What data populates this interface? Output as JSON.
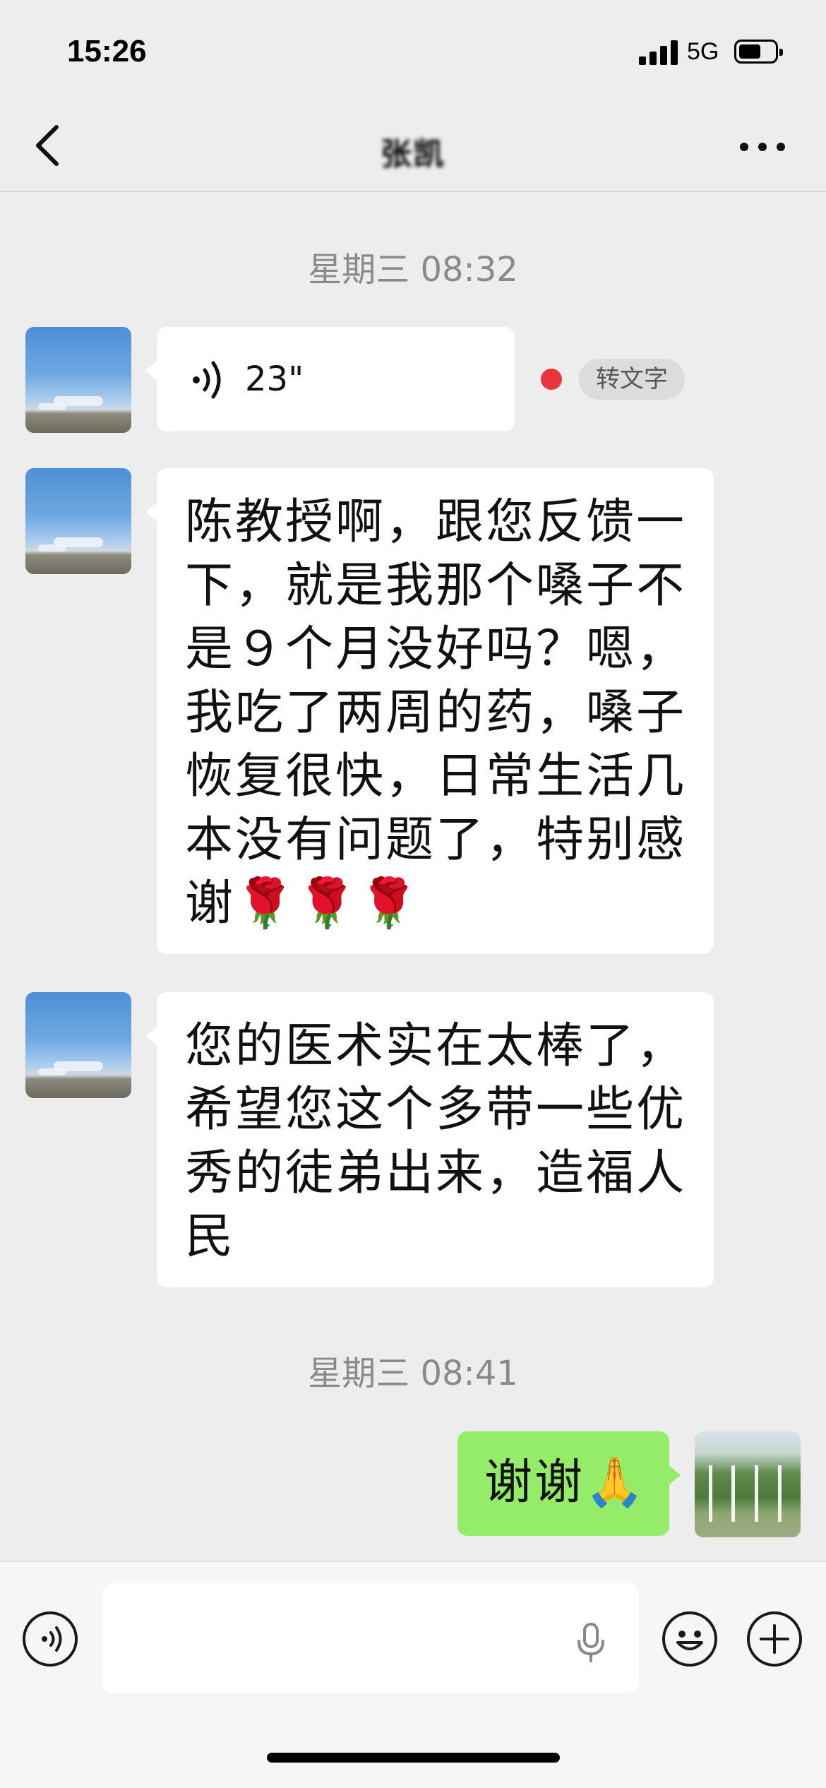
{
  "status": {
    "time": "15:26",
    "network": "5G"
  },
  "header": {
    "title": "张凯"
  },
  "messages": {
    "divider1": "星期三 08:32",
    "voice": {
      "duration": "23\"",
      "to_text": "转文字"
    },
    "msg1": {
      "line1": "陈教授啊，跟您反馈一",
      "line2": "下，就是我那个嗓子不",
      "line3": "是９个月没好吗？嗯，",
      "line4": "我吃了两周的药，嗓子",
      "line5": "恢复很快，日常生活几",
      "line6": "本没有问题了，特别感",
      "line7": "谢🌹🌹🌹"
    },
    "msg2": {
      "line1": "您的医术实在太棒了，",
      "line2": "希望您这个多带一些优",
      "line3": "秀的徒弟出来，造福人",
      "line4": "民"
    },
    "divider2": "星期三 08:41",
    "reply": "谢谢🙏"
  },
  "colors": {
    "bubble_mine": "#95ec69",
    "background": "#ededed",
    "unread_dot": "#e8343c"
  },
  "icons": [
    "back-icon",
    "more-icon",
    "voice-wave-icon",
    "voice-mode-icon",
    "mic-icon",
    "emoji-icon",
    "plus-icon"
  ]
}
